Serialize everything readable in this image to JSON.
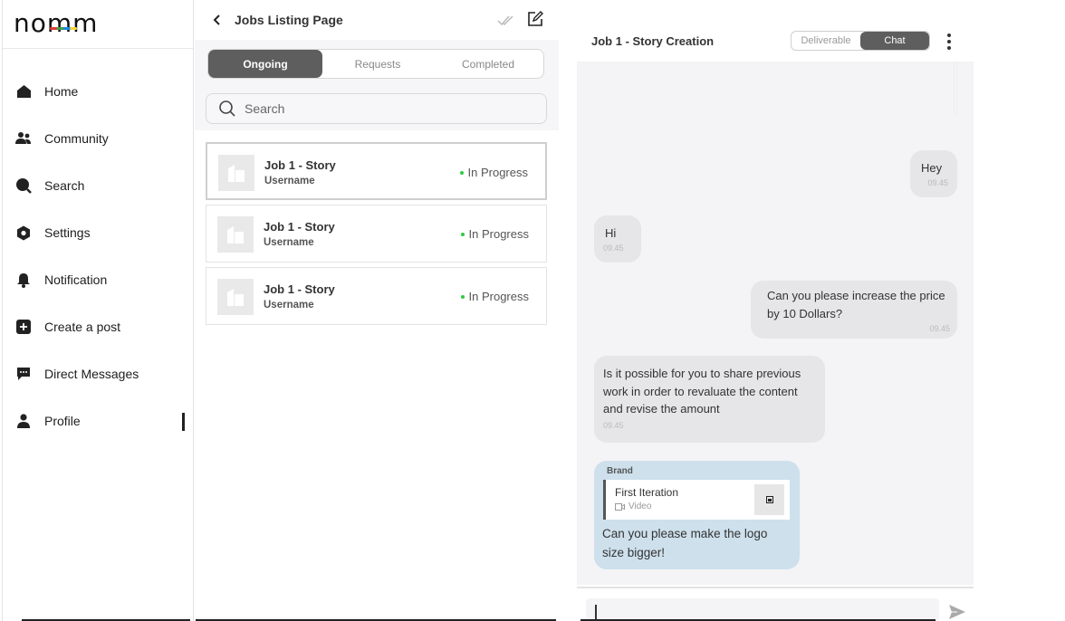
{
  "app": {
    "logo": "nomm"
  },
  "sidebar": {
    "items": [
      {
        "label": "Home",
        "icon": "home-icon"
      },
      {
        "label": "Community",
        "icon": "community-icon"
      },
      {
        "label": "Search",
        "icon": "search-icon"
      },
      {
        "label": "Settings",
        "icon": "settings-icon"
      },
      {
        "label": "Notification",
        "icon": "bell-icon"
      },
      {
        "label": "Create a post",
        "icon": "plus-icon"
      },
      {
        "label": "Direct Messages",
        "icon": "message-icon"
      },
      {
        "label": "Profile",
        "icon": "person-icon"
      }
    ],
    "active": "Profile"
  },
  "jobs": {
    "title": "Jobs Listing Page",
    "tabs": [
      {
        "label": "Ongoing",
        "active": true
      },
      {
        "label": "Requests",
        "active": false
      },
      {
        "label": "Completed",
        "active": false
      }
    ],
    "search_placeholder": "Search",
    "cards": [
      {
        "title": "Job 1 - Story",
        "user": "Username",
        "status": "In Progress",
        "selected": true
      },
      {
        "title": "Job 1 - Story",
        "user": "Username",
        "status": "In Progress",
        "selected": false
      },
      {
        "title": "Job 1 - Story",
        "user": "Username",
        "status": "In Progress",
        "selected": false
      }
    ],
    "status_color": "#2ecc40"
  },
  "chat": {
    "title": "Job 1 - Story Creation",
    "toggle": [
      {
        "label": "Deliverable",
        "active": false
      },
      {
        "label": "Chat",
        "active": true
      }
    ],
    "messages": [
      {
        "text": "Hey",
        "time": "09.45",
        "direction": "out"
      },
      {
        "text": "Hi",
        "time": "09.45",
        "direction": "in"
      },
      {
        "text": "Can you please increase the price by 10 Dollars?",
        "time": "09.45",
        "direction": "out"
      },
      {
        "text": "Is it possible for you to share previous work in order to revaluate the content and revise the amount",
        "time": "09.45",
        "direction": "in"
      }
    ],
    "brand_message": {
      "sender": "Brand",
      "attachment_title": "First Iteration",
      "attachment_type": "Video",
      "text": "Can you please make the logo size bigger!",
      "bubble_color": "#cde0ec"
    },
    "input_value": ""
  }
}
